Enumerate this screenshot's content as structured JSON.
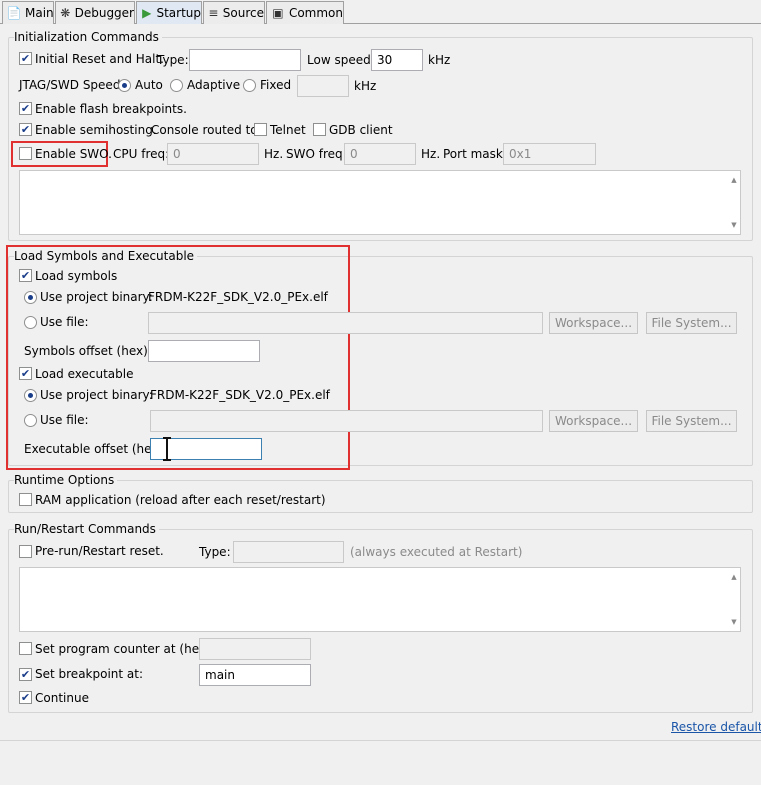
{
  "tabs": [
    {
      "label": "Main",
      "icon": "page-icon"
    },
    {
      "label": "Debugger",
      "icon": "bug-icon"
    },
    {
      "label": "Startup",
      "icon": "play-icon"
    },
    {
      "label": "Source",
      "icon": "source-icon"
    },
    {
      "label": "Common",
      "icon": "window-icon"
    }
  ],
  "init": {
    "title": "Initialization Commands",
    "initial_reset_label": "Initial Reset and Halt.",
    "type_label": "Type:",
    "type_value": "",
    "low_speed_label": "Low speed:",
    "low_speed_value": "30",
    "khz": "kHz",
    "jtag_label": "JTAG/SWD Speed:",
    "auto_label": "Auto",
    "adaptive_label": "Adaptive",
    "fixed_label": "Fixed",
    "fixed_value": "",
    "flash_bp_label": "Enable flash breakpoints.",
    "semihosting_label": "Enable semihosting.",
    "console_label": "Console routed to:",
    "telnet_label": "Telnet",
    "gdb_label": "GDB client",
    "swo_label": "Enable SWO.",
    "cpu_freq_label": "CPU freq:",
    "cpu_freq_value": "0",
    "hz1": "Hz.",
    "swo_freq_label": "SWO freq:",
    "swo_freq_value": "0",
    "hz2": "Hz.",
    "port_mask_label": "Port mask:",
    "port_mask_value": "0x1"
  },
  "load": {
    "title": "Load Symbols and Executable",
    "load_symbols_label": "Load symbols",
    "use_project_binary_label": "Use project binary:",
    "symbols_binary": "FRDM-K22F_SDK_V2.0_PEx.elf",
    "use_file_label": "Use file:",
    "workspace_label": "Workspace...",
    "filesystem_label": "File System...",
    "symbols_offset_label": "Symbols offset (hex):",
    "load_executable_label": "Load executable",
    "use_project_binary_label2": "Use project binary:",
    "exec_binary": "FRDM-K22F_SDK_V2.0_PEx.elf",
    "use_file_label2": "Use file:",
    "workspace_label2": "Workspace...",
    "filesystem_label2": "File System...",
    "exec_offset_label": "Executable offset (hex):"
  },
  "runtime": {
    "title": "Runtime Options",
    "ram_label": "RAM application (reload after each reset/restart)"
  },
  "restart": {
    "title": "Run/Restart Commands",
    "prerun_label": "Pre-run/Restart reset.",
    "type_label": "Type:",
    "always_label": "(always executed at Restart)",
    "set_pc_label": "Set program counter at (hex):",
    "set_bp_label": "Set breakpoint at:",
    "bp_value": "main",
    "continue_label": "Continue"
  },
  "restore_defaults": "Restore defaults",
  "colors": {
    "highlight": "#e03030",
    "link": "#1a55a8"
  }
}
